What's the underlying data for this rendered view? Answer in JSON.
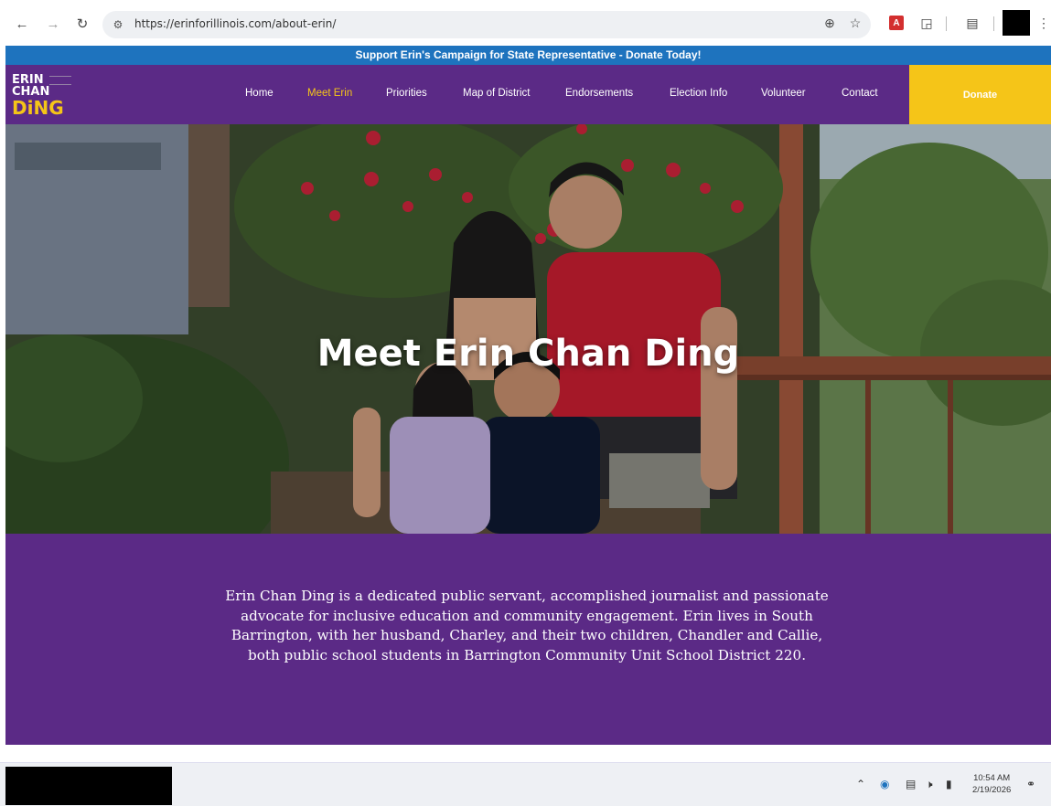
{
  "browser": {
    "url": "https://erinforillinois.com/about-erin/"
  },
  "site": {
    "banner": "Support Erin's Campaign for State Representative - Donate Today!",
    "logo": {
      "line1": "ERIN",
      "line2": "CHAN",
      "line3": "DiNG"
    },
    "nav": [
      {
        "label": "Home",
        "active": false
      },
      {
        "label": "Meet Erin",
        "active": true
      },
      {
        "label": "Priorities",
        "active": false
      },
      {
        "label": "Map of District",
        "active": false
      },
      {
        "label": "Endorsements",
        "active": false
      },
      {
        "label": "Election Info",
        "active": false
      },
      {
        "label": "Volunteer",
        "active": false
      },
      {
        "label": "Contact",
        "active": false
      }
    ],
    "donate_label": "Donate",
    "hero_title": "Meet Erin Chan Ding",
    "about_text": "Erin Chan Ding is a dedicated public servant, accomplished journalist and passionate advocate for inclusive education and community engagement. Erin lives in South Barrington, with her husband, Charley, and their two children, Chandler and Callie, both public school students in Barrington Community Unit School District 220."
  },
  "taskbar": {
    "time": "10:54 AM",
    "date": "2/19/2026"
  },
  "colors": {
    "banner": "#1e73be",
    "brand_purple": "#5b2a86",
    "accent_gold": "#f5c518"
  },
  "icons": [
    "back-arrow-icon",
    "forward-arrow-icon",
    "reload-icon",
    "site-settings-icon",
    "zoom-icon",
    "star-icon",
    "pdf-icon",
    "extensions-icon",
    "reading-list-icon",
    "more-menu-icon"
  ]
}
